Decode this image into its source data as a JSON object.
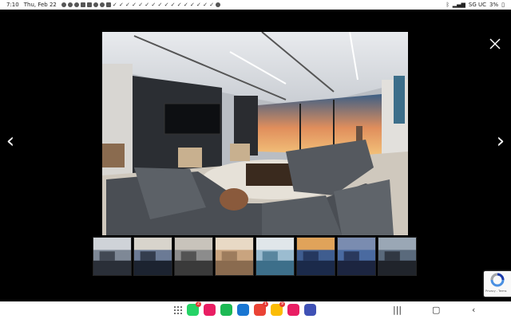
{
  "status": {
    "time": "7:10",
    "date": "Thu, Feb 22",
    "carrier": "SG UC",
    "battery": "3%"
  },
  "viewer": {
    "prev_arrow": "‹",
    "next_arrow": "›"
  },
  "thumbnails": [
    {
      "name": "living-room",
      "colors": [
        "#2a2f38",
        "#7e8896",
        "#cfd3d8"
      ]
    },
    {
      "name": "dining-view",
      "colors": [
        "#1c2330",
        "#6b7a95",
        "#d8d4cc"
      ]
    },
    {
      "name": "kitchen",
      "colors": [
        "#3a3a3a",
        "#8c8c8c",
        "#c8c3bb"
      ]
    },
    {
      "name": "bathroom",
      "colors": [
        "#8a6b4f",
        "#c9a47f",
        "#e8d9c5"
      ]
    },
    {
      "name": "exterior-pool-day",
      "colors": [
        "#3d6f8a",
        "#9bbcd0",
        "#e0e6ea"
      ]
    },
    {
      "name": "exterior-pool-dusk",
      "colors": [
        "#1b2a4a",
        "#3f5d8f",
        "#e0a35a"
      ]
    },
    {
      "name": "aerial-dusk",
      "colors": [
        "#1c2540",
        "#4a6aa0",
        "#7a8cb0"
      ]
    },
    {
      "name": "media-room",
      "colors": [
        "#20242b",
        "#5a6a7c",
        "#9aa7b5"
      ]
    }
  ],
  "recaptcha": {
    "footer": "Privacy - Terms"
  },
  "dock": {
    "apps": [
      {
        "name": "whatsapp",
        "color": "#25d366",
        "badge": "2"
      },
      {
        "name": "phone",
        "color": "#e91e63",
        "badge": ""
      },
      {
        "name": "messages-green",
        "color": "#1db954",
        "badge": ""
      },
      {
        "name": "messages-blue",
        "color": "#1976d2",
        "badge": ""
      },
      {
        "name": "gmail",
        "color": "#ea4335",
        "badge": "1"
      },
      {
        "name": "chrome",
        "color": "#fbbc05",
        "badge": "9"
      },
      {
        "name": "galaxy-store",
        "color": "#e91e63",
        "badge": ""
      },
      {
        "name": "settings",
        "color": "#3f51b5",
        "badge": ""
      }
    ]
  }
}
